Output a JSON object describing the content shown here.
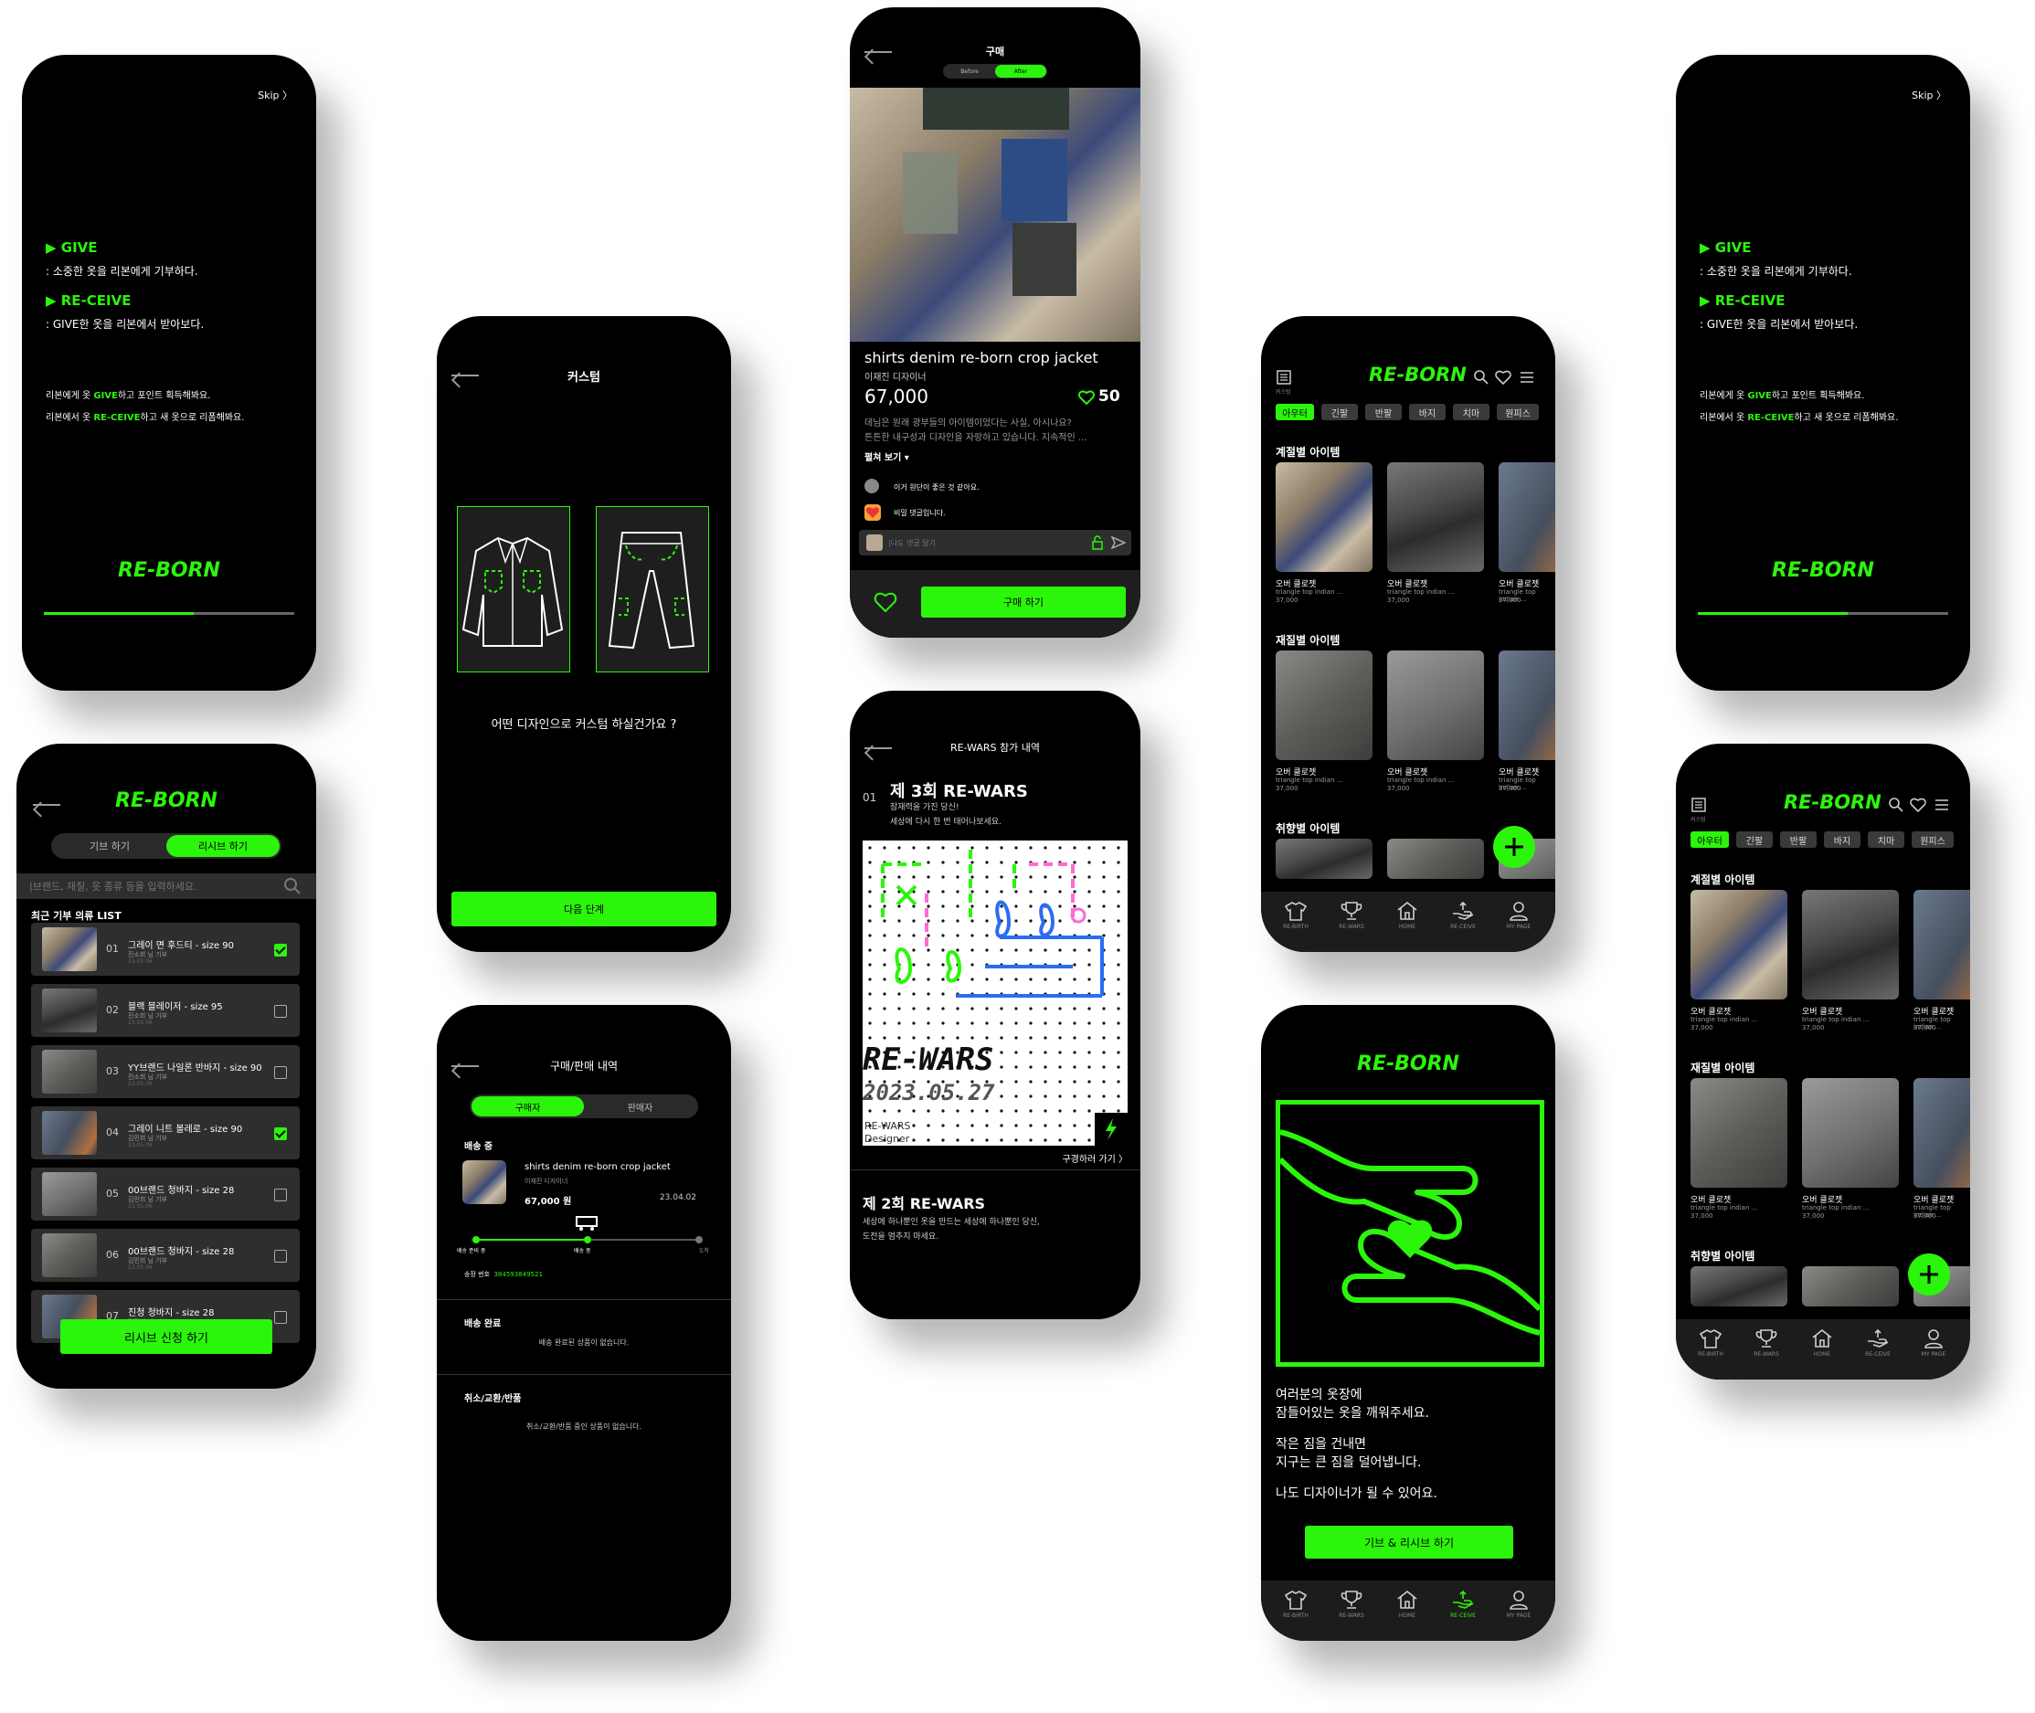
{
  "colors": {
    "accent": "#2cf50c",
    "bg": "#000000",
    "card": "#2e2e2e"
  },
  "onboard": {
    "skip": "Skip 〉",
    "give_head": "▶ GIVE",
    "give_desc": ": 소중한 옷을 리본에게 기부하다.",
    "receive_head": "▶ RE-CEIVE",
    "receive_desc": ": GIVE한 옷을 리본에서 받아보다.",
    "line1_pre": "리본에게 옷 ",
    "line1_em": "GIVE",
    "line1_post": "하고 포인트 획득해봐요.",
    "line2_pre": "리본에서 옷 ",
    "line2_em": "RE-CEIVE",
    "line2_post": "하고 새 옷으로 리폼해봐요.",
    "logo": "RE-BORN",
    "progress_fraction": 0.6
  },
  "custom": {
    "title": "커스텀",
    "question": "어떤 디자인으로 커스텀 하실건가요 ?",
    "next": "다음 단계"
  },
  "product": {
    "title": "구매",
    "before": "Before",
    "after": "After",
    "name": "shirts denim re-born crop jacket",
    "designer": "이재진 디자이너",
    "price": "67,000",
    "likes": "50",
    "desc1": "데님은 원래 광부들의 아이템이었다는 사실, 아시나요?",
    "desc2": "튼튼한 내구성과 디자인을 자랑하고 있습니다. 지속적인 ...",
    "more": "펼쳐 보기 ▾",
    "comment1": "이거 원단이 좋은 것 같아요.",
    "comment2": "비밀 댓글입니다.",
    "comment_placeholder": "|나도 댓글 달기",
    "buy": "구매 하기"
  },
  "home": {
    "logo": "RE-BORN",
    "chips": [
      "아우터",
      "긴팔",
      "반팔",
      "바지",
      "치마",
      "원피스"
    ],
    "sec_season": "계절별 아이템",
    "sec_material": "재질별 아이템",
    "sec_taste": "취향별 아이템",
    "item_name": "오버 클로젯",
    "item_sub": "triangle top indian ...",
    "item_price": "37,000",
    "nav": [
      "RE-BIRTH",
      "RE-WARS",
      "HOME",
      "RE-CEIVE",
      "MY PAGE"
    ],
    "menu_caption": "커스텀"
  },
  "rewars": {
    "title": "RE-WARS 참가 내역",
    "num": "01",
    "ep3": "제 3회 RE-WARS",
    "ep3_sub1": "잠재력을 가진 당신!",
    "ep3_sub2": "세상에 다시 한 번 태어나보세요.",
    "poster_title": "RE-WARS",
    "poster_date": "2023.05.27",
    "poster_tag1": "RE-WARS",
    "poster_tag2": "Designer",
    "view": "구경하러 가기 〉",
    "ep2": "제 2회 RE-WARS",
    "ep2_sub1": "세상에 하나뿐인 옷을 만드는 세상에 하나뿐인 당신,",
    "ep2_sub2": "도전을 멈추지 마세요."
  },
  "receive_list": {
    "logo": "RE-BORN",
    "tab1": "기브 하기",
    "tab2": "리시브 하기",
    "search_placeholder": "|브랜드, 재질, 옷 종류 등을 입력하세요.",
    "list_title": "최근 기부 의류 LIST",
    "items": [
      {
        "num": "01",
        "name": "그레이 면 후드티 - size 90",
        "sub": "진소희 님 기부",
        "date": "23.05.06",
        "checked": true
      },
      {
        "num": "02",
        "name": "블랙 블레이저 - size 95",
        "sub": "진소희 님 기부",
        "date": "23.05.06",
        "checked": false
      },
      {
        "num": "03",
        "name": "YY브랜드 나일론 반바지 - size 90",
        "sub": "진소희 님 기부",
        "date": "23.05.06",
        "checked": false
      },
      {
        "num": "04",
        "name": "그레이 니트 볼레로 - size 90",
        "sub": "김민희 님 기부",
        "date": "23.05.06",
        "checked": true
      },
      {
        "num": "05",
        "name": "00브랜드 청바지 - size 28",
        "sub": "김민희 님 기부",
        "date": "23.05.06",
        "checked": false
      },
      {
        "num": "06",
        "name": "00브랜드 청바지 - size 28",
        "sub": "김민희 님 기부",
        "date": "23.05.06",
        "checked": false
      },
      {
        "num": "07",
        "name": "진청 청바지 - size 28",
        "sub": "김민희 님 기부",
        "date": "23.05.06",
        "checked": false
      }
    ],
    "apply": "리시브 신청 하기"
  },
  "orders": {
    "title": "구매/판매 내역",
    "tab1": "구매자",
    "tab2": "판매자",
    "shipping": "배송 중",
    "item_name": "shirts denim re-born crop jacket",
    "item_designer": "이재진 디자이너",
    "item_price": "67,000 원",
    "item_date": "23.04.02",
    "steps": [
      "배송 준비 중",
      "배송 중",
      "도착"
    ],
    "tracking_label": "송장 번호",
    "tracking_no": "384593849521",
    "done_title": "배송 완료",
    "done_empty": "배송 완료된 상품이 없습니다.",
    "cancel_title": "취소/교환/반품",
    "cancel_empty": "취소/교환/반품 중인 상품이 없습니다."
  },
  "give_main": {
    "logo": "RE-BORN",
    "p1a": "여러분의 옷장에",
    "p1b": "잠들어있는 옷을 깨워주세요.",
    "p2a": "작은 짐을 건내면",
    "p2b": "지구는 큰 짐을 덜어냅니다.",
    "p3": "나도 디자이너가 될 수 있어요.",
    "cta": "기브 & 리시브 하기"
  }
}
